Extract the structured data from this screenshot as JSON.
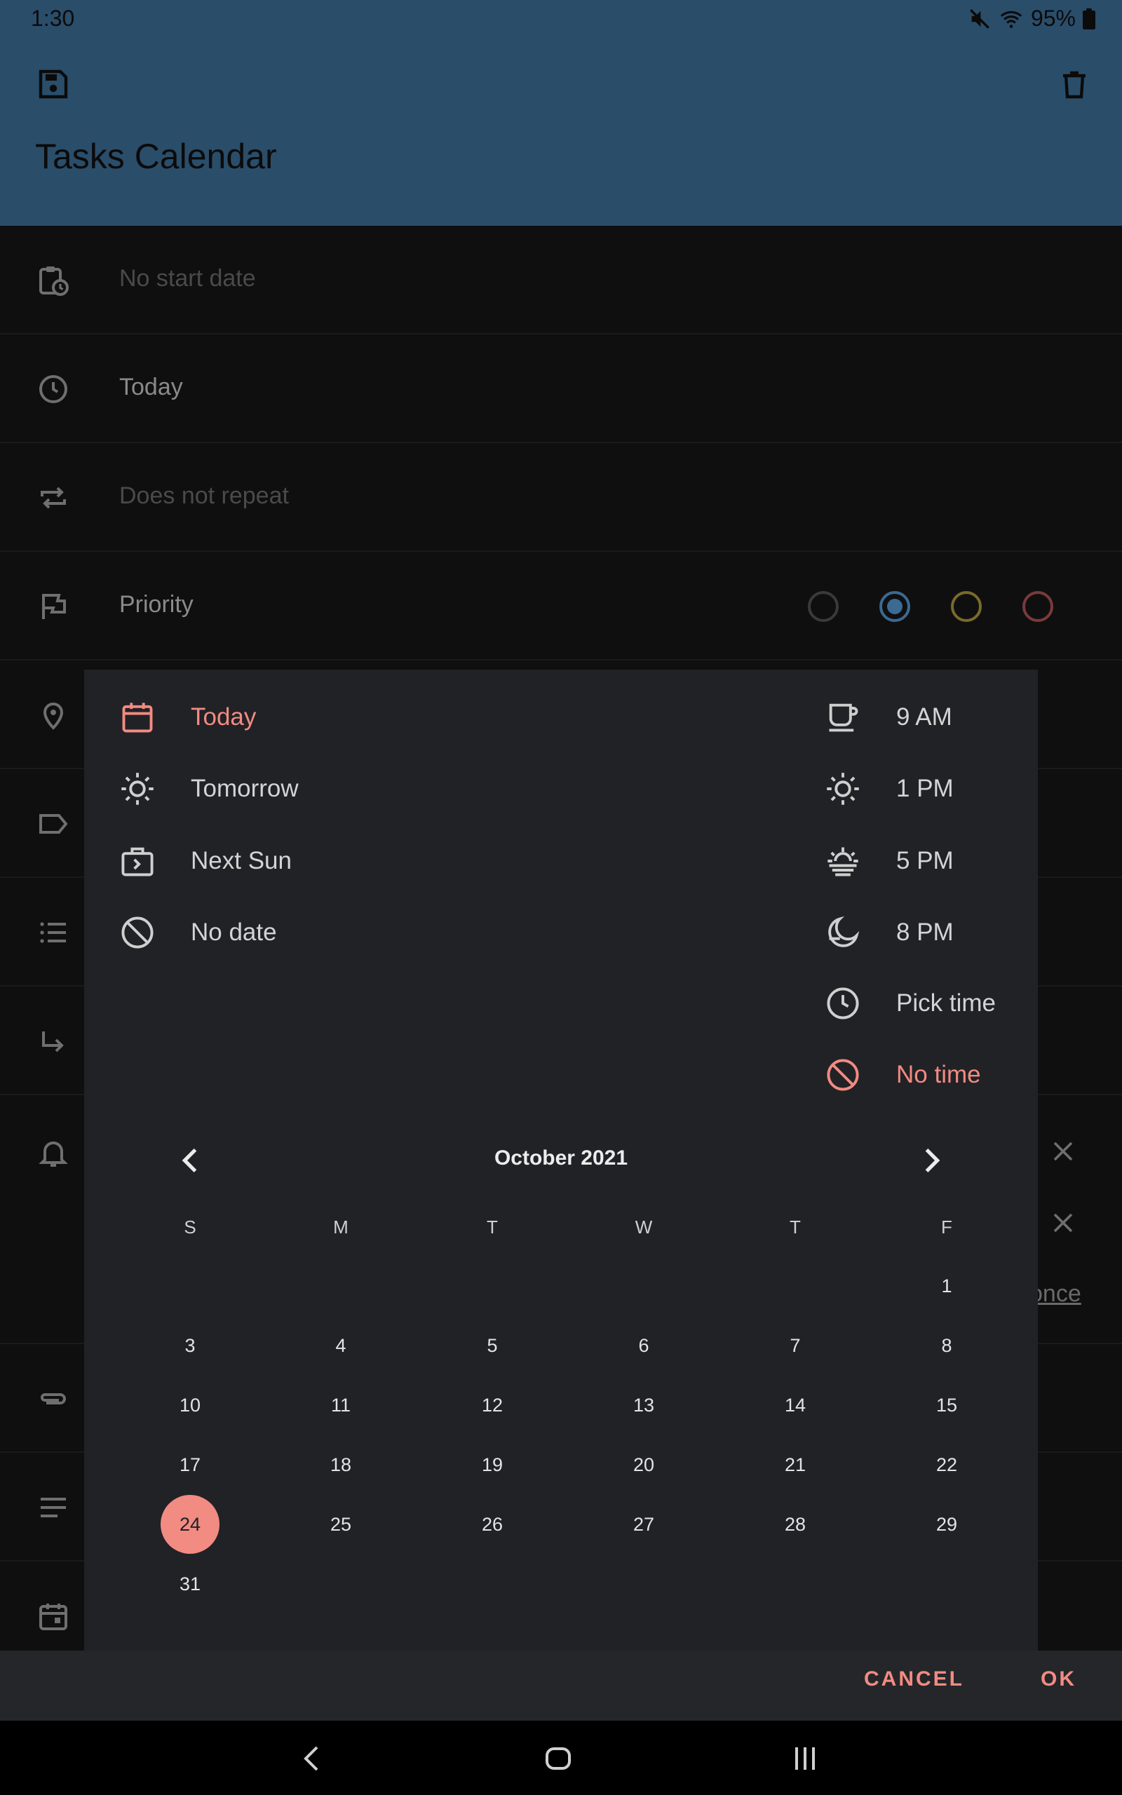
{
  "status": {
    "time": "1:30",
    "battery": "95%"
  },
  "header": {
    "title": "Tasks Calendar"
  },
  "background": {
    "start_date": "No start date",
    "due": "Today",
    "repeat": "Does not repeat",
    "priority": "Priority",
    "once_link": "once",
    "priority_colors": [
      "#3a3a3a",
      "#3b6a92",
      "#7a6a2a",
      "#7a3a3a"
    ]
  },
  "dialog": {
    "date_options": [
      {
        "label": "Today",
        "icon": "calendar-icon",
        "selected": true
      },
      {
        "label": "Tomorrow",
        "icon": "sun-icon",
        "selected": false
      },
      {
        "label": "Next Sun",
        "icon": "briefcase-icon",
        "selected": false
      },
      {
        "label": "No date",
        "icon": "block-icon",
        "selected": false
      }
    ],
    "time_options": [
      {
        "label": "9 AM",
        "icon": "coffee-icon",
        "selected": false
      },
      {
        "label": "1 PM",
        "icon": "sun-icon",
        "selected": false
      },
      {
        "label": "5 PM",
        "icon": "sunset-icon",
        "selected": false
      },
      {
        "label": "8 PM",
        "icon": "moon-icon",
        "selected": false
      },
      {
        "label": "Pick time",
        "icon": "clock-icon",
        "selected": false
      },
      {
        "label": "No time",
        "icon": "block-icon",
        "selected": true
      }
    ],
    "calendar": {
      "month": "October 2021",
      "weekdays": [
        "S",
        "M",
        "T",
        "W",
        "T",
        "F"
      ],
      "weeks": [
        [
          "",
          "",
          "",
          "",
          "",
          "1"
        ],
        [
          "3",
          "4",
          "5",
          "6",
          "7",
          "8"
        ],
        [
          "10",
          "11",
          "12",
          "13",
          "14",
          "15"
        ],
        [
          "17",
          "18",
          "19",
          "20",
          "21",
          "22"
        ],
        [
          "24",
          "25",
          "26",
          "27",
          "28",
          "29"
        ],
        [
          "31",
          "",
          "",
          "",
          "",
          ""
        ]
      ],
      "selected_day": "24"
    },
    "cancel": "CANCEL",
    "ok": "OK"
  },
  "colors": {
    "accent": "#f28b82",
    "header": "#2a4d6a",
    "dialog": "#212226"
  }
}
